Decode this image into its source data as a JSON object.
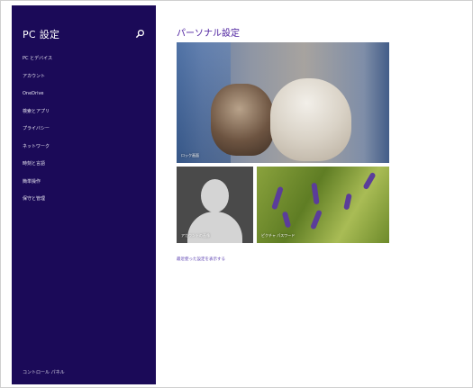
{
  "sidebar": {
    "title": "PC 設定",
    "search_icon": "search-icon",
    "items": [
      {
        "label": "PC とデバイス"
      },
      {
        "label": "アカウント"
      },
      {
        "label": "OneDrive"
      },
      {
        "label": "検索とアプリ"
      },
      {
        "label": "プライバシー"
      },
      {
        "label": "ネットワーク"
      },
      {
        "label": "時刻と言語"
      },
      {
        "label": "簡単操作"
      },
      {
        "label": "保守と管理"
      }
    ],
    "footer_label": "コントロール パネル"
  },
  "main": {
    "title": "パーソナル設定",
    "tiles": [
      {
        "label": "ロック画面"
      },
      {
        "label": "アカウントの画像"
      },
      {
        "label": "ピクチャ パスワード"
      }
    ],
    "recent_link": "最近使った設定を表示する"
  },
  "colors": {
    "sidebar_bg": "#1b0a58",
    "accent": "#4b1e9e",
    "link": "#5a3fb0"
  }
}
